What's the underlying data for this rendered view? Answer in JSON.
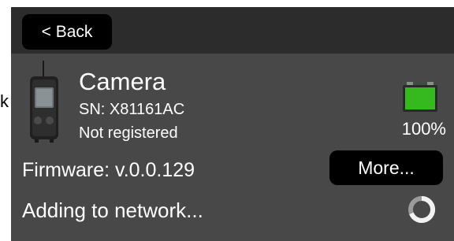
{
  "header": {
    "back_label": "< Back"
  },
  "device": {
    "name": "Camera",
    "serial": "SN: X81161AC",
    "registration": "Not registered",
    "firmware": "Firmware: v.0.0.129"
  },
  "battery": {
    "level_percent": 100,
    "label": "100%",
    "fill_color": "#36b81f"
  },
  "actions": {
    "more_label": "More..."
  },
  "status": {
    "text": "Adding to network...",
    "icon": "loading-spinner-icon"
  },
  "edge": {
    "clipped_text": "k"
  },
  "colors": {
    "panel": "#484848",
    "topbar": "#2c2c2c",
    "button": "#000000",
    "text": "#ffffff"
  }
}
